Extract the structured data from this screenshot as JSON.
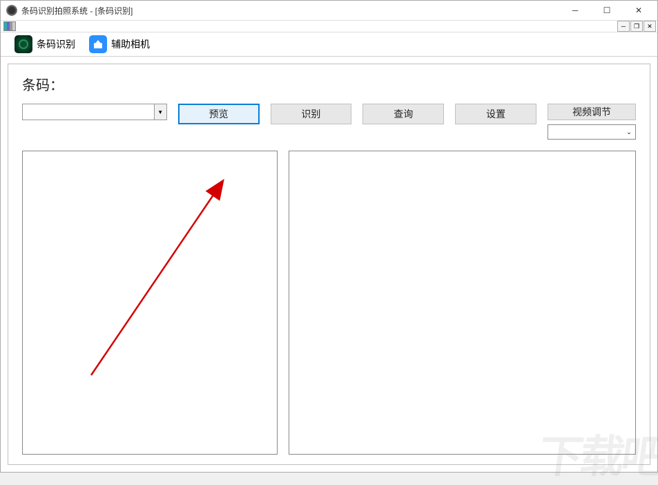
{
  "window": {
    "title": "条码识别拍照系统 - [条码识别]"
  },
  "tabs": {
    "barcode": "条码识别",
    "camera": "辅助相机"
  },
  "main": {
    "barcode_label": "条码：",
    "combo_value": "",
    "buttons": {
      "preview": "预览",
      "recognize": "识别",
      "query": "查询",
      "settings": "设置",
      "video_adjust": "视频调节"
    },
    "select_value": ""
  },
  "watermark": "下载吧",
  "icons": {
    "barcode": "barcode-icon",
    "camera": "camera-icon",
    "minimize": "─",
    "maximize": "☐",
    "close": "✕",
    "mdi_min": "─",
    "mdi_restore": "❐",
    "mdi_close": "✕",
    "dropdown": "▼",
    "select_arrow": "⌄"
  }
}
